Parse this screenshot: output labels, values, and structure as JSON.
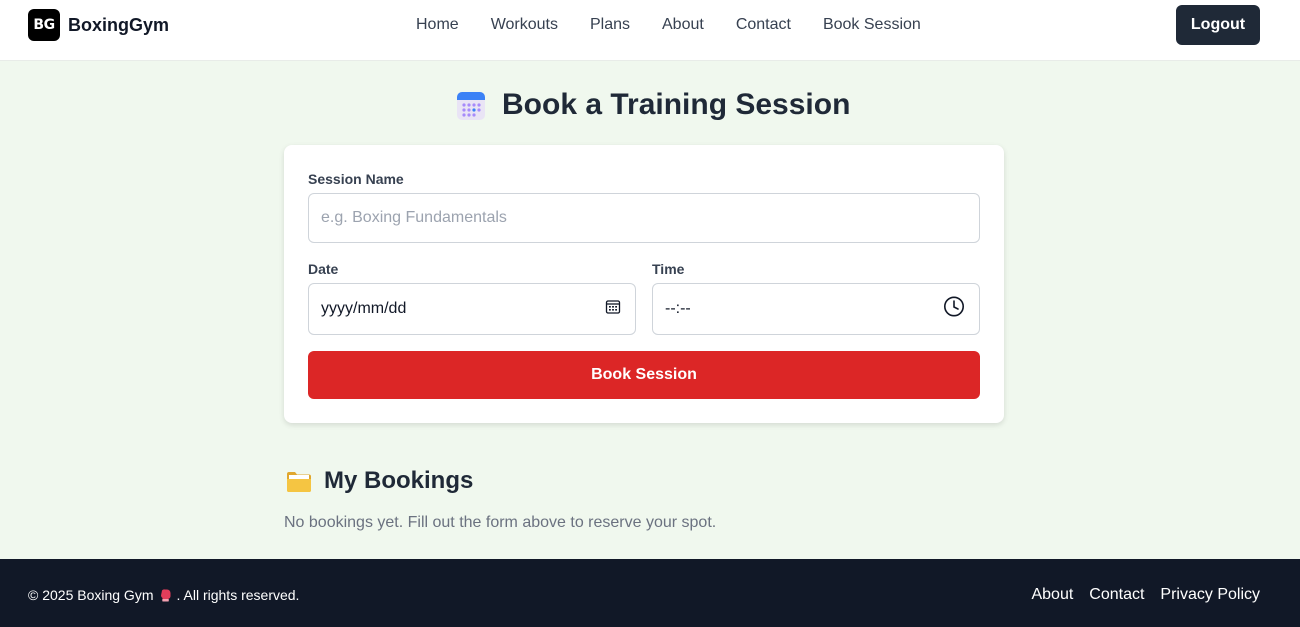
{
  "brand": {
    "logo_text": "BG",
    "name": "BoxingGym"
  },
  "nav": {
    "links": [
      {
        "label": "Home"
      },
      {
        "label": "Workouts"
      },
      {
        "label": "Plans"
      },
      {
        "label": "About"
      },
      {
        "label": "Contact"
      },
      {
        "label": "Book Session"
      }
    ],
    "logout_label": "Logout"
  },
  "page": {
    "title": "Book a Training Session",
    "title_icon": "calendar-icon"
  },
  "form": {
    "session_name": {
      "label": "Session Name",
      "placeholder": "e.g. Boxing Fundamentals",
      "value": ""
    },
    "date": {
      "label": "Date",
      "value": "yyyy/mm/dd",
      "icon": "calendar-picker-icon"
    },
    "time": {
      "label": "Time",
      "value": "--:--",
      "icon": "clock-icon"
    },
    "submit_label": "Book Session"
  },
  "bookings": {
    "title": "My Bookings",
    "icon": "folder-icon",
    "empty_message": "No bookings yet. Fill out the form above to reserve your spot."
  },
  "footer": {
    "copyright_prefix": "© 2025 Boxing Gym",
    "copyright_suffix": ". All rights reserved.",
    "icon": "boxing-glove-icon",
    "links": [
      {
        "label": "About"
      },
      {
        "label": "Contact"
      },
      {
        "label": "Privacy Policy"
      }
    ]
  },
  "colors": {
    "page_background": "#f0f8ee",
    "primary_button": "#dc2626",
    "dark": "#1f2937",
    "footer_background": "#111827"
  }
}
